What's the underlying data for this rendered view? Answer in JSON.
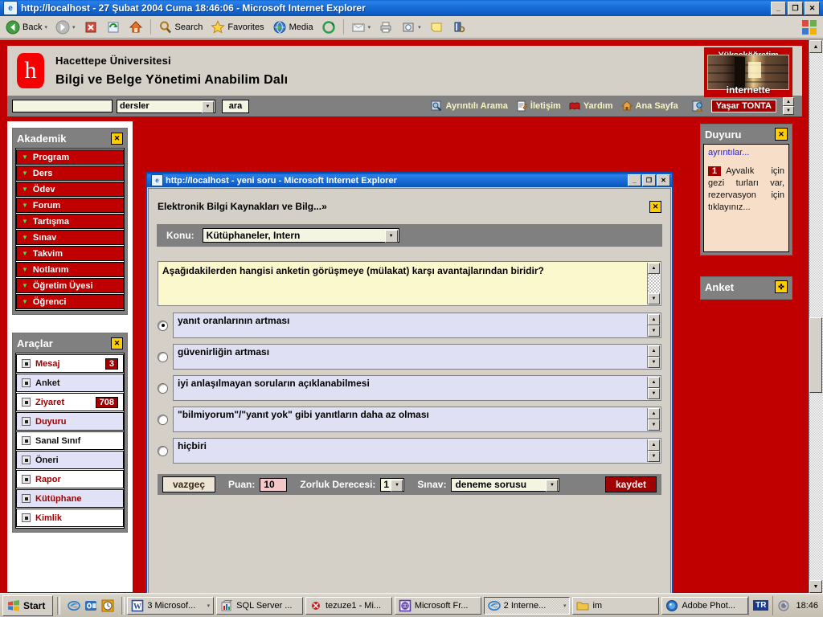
{
  "browser": {
    "title": "http://localhost - 27 Şubat 2004 Cuma 18:46:06 - Microsoft Internet Explorer",
    "title_icon": "ie-page-icon",
    "window_controls": {
      "minimize": "_",
      "maximize": "❐",
      "close": "✕"
    },
    "toolbar": {
      "back": "Back",
      "forward": "",
      "stop_icon": "stop-icon",
      "refresh_icon": "refresh-icon",
      "home_icon": "home-icon",
      "search": "Search",
      "favorites": "Favorites",
      "media": "Media",
      "history_icon": "history-icon",
      "mail_icon": "mail-icon",
      "print_icon": "print-icon",
      "discuss_icon": "discuss-icon",
      "notes_icon": "notes-icon",
      "research_icon": "research-icon",
      "dropdown_arrow": "▾"
    }
  },
  "site": {
    "logo_glyph": "h",
    "line1": "Hacettepe Üniversitesi",
    "line2": "Bilgi ve Belge Yönetimi Anabilim Dalı",
    "right_logo": {
      "top_text": "Yükseköğretim",
      "bottom_text": "internette"
    },
    "search": {
      "input_value": "",
      "input_placeholder": "",
      "select_value": "dersler",
      "select_arrow": "▼",
      "button_label": "ara"
    },
    "nav": [
      {
        "label": "Ayrıntılı Arama",
        "icon": "detailed-search-icon"
      },
      {
        "label": "İletişim",
        "icon": "contact-icon"
      },
      {
        "label": "Yardım",
        "icon": "help-book-icon"
      },
      {
        "label": "Ana Sayfa",
        "icon": "home-icon"
      }
    ],
    "user": {
      "icon": "user-icon",
      "name": "Yaşar TONTA"
    }
  },
  "sidebar_left": {
    "akademik": {
      "title": "Akademik",
      "close_label": "✕",
      "items": [
        {
          "label": "Program"
        },
        {
          "label": "Ders"
        },
        {
          "label": "Ödev"
        },
        {
          "label": "Forum"
        },
        {
          "label": "Tartışma"
        },
        {
          "label": "Sınav"
        },
        {
          "label": "Takvim"
        },
        {
          "label": "Notlarım"
        },
        {
          "label": "Öğretim Üyesi"
        },
        {
          "label": "Öğrenci"
        }
      ]
    },
    "araclar": {
      "title": "Araçlar",
      "close_label": "✕",
      "items": [
        {
          "label": "Mesaj",
          "count": "3",
          "style": "red-text"
        },
        {
          "label": "Anket",
          "count": "",
          "style": "dark-text"
        },
        {
          "label": "Ziyaret",
          "count": "708",
          "style": "red-text"
        },
        {
          "label": "Duyuru",
          "count": "",
          "style": "red-text"
        },
        {
          "label": "Sanal Sınıf",
          "count": "",
          "style": "dark-text"
        },
        {
          "label": "Öneri",
          "count": "",
          "style": "dark-text"
        },
        {
          "label": "Rapor",
          "count": "",
          "style": "red-text"
        },
        {
          "label": "Kütüphane",
          "count": "",
          "style": "red-text"
        },
        {
          "label": "Kimlik",
          "count": "",
          "style": "red-text"
        }
      ]
    }
  },
  "sidebar_right": {
    "duyuru": {
      "title": "Duyuru",
      "close_label": "✕",
      "link": "ayrıntılar...",
      "badge": "1",
      "text": "Ayvalık için gezi turları var, rezervasyon için tıklayınız..."
    },
    "anket": {
      "title": "Anket",
      "icon_label": "✜"
    }
  },
  "popup": {
    "title": "http://localhost - yeni soru - Microsoft Internet Explorer",
    "title_icon": "ie-page-icon",
    "window_controls": {
      "minimize": "_",
      "maximize": "❐",
      "close": "✕"
    },
    "heading": "Elektronik Bilgi Kaynakları ve Bilg...»",
    "close_label": "✕",
    "konu": {
      "label": "Konu:",
      "value": "Kütüphaneler, Intern",
      "arrow": "▼"
    },
    "question": "Aşağıdakilerden hangisi anketin görüşmeye (mülakat) karşı avantajlarından biridir?",
    "options": [
      {
        "text": "yanıt oranlarının artması",
        "selected": true
      },
      {
        "text": "güvenirliğin artması",
        "selected": false
      },
      {
        "text": "iyi anlaşılmayan soruların açıklanabilmesi",
        "selected": false
      },
      {
        "text": "\"bilmiyorum\"/\"yanıt yok\" gibi yanıtların daha az olması",
        "selected": false
      },
      {
        "text": " hiçbiri",
        "selected": false
      }
    ],
    "footer": {
      "cancel_label": "vazgeç",
      "puan_label": "Puan:",
      "puan_value": "10",
      "zorluk_label": "Zorluk Derecesi:",
      "zorluk_value": "1",
      "zorluk_arrow": "▼",
      "sinav_label": "Sınav:",
      "sinav_value": "deneme sorusu",
      "sinav_arrow": "▼",
      "save_label": "kaydet"
    },
    "scroll_up": "▲",
    "scroll_down": "▼"
  },
  "taskbar": {
    "start_label": "Start",
    "quicklaunch": [
      {
        "icon": "ie-icon"
      },
      {
        "icon": "outlook-icon"
      },
      {
        "icon": "clock-icon"
      }
    ],
    "items": [
      {
        "label": "3 Microsof...",
        "icon": "word-icon",
        "active": false,
        "group": true
      },
      {
        "label": "SQL Server ...",
        "icon": "sql-icon",
        "active": false,
        "group": false
      },
      {
        "label": "tezuze1 - Mi...",
        "icon": "access-icon",
        "active": false,
        "group": false
      },
      {
        "label": "Microsoft Fr...",
        "icon": "frontpage-icon",
        "active": false,
        "group": false
      },
      {
        "label": "2 Interne...",
        "icon": "ie-icon",
        "active": true,
        "group": true
      },
      {
        "label": "im",
        "icon": "folder-icon",
        "active": false,
        "group": false
      },
      {
        "label": "Adobe Phot...",
        "icon": "photoshop-icon",
        "active": false,
        "group": false
      }
    ],
    "tray": {
      "language": "TR",
      "icon": "volume-icon",
      "clock": "18:46"
    }
  },
  "colors": {
    "brand_red": "#c00000",
    "dark_red": "#a00000",
    "panel_gray": "#808080",
    "accent_yellow": "#ffcc00",
    "question_bg": "#fcf8cd",
    "option_bg": "#e0e0f4",
    "titlebar_blue": "#0a5bc4"
  }
}
